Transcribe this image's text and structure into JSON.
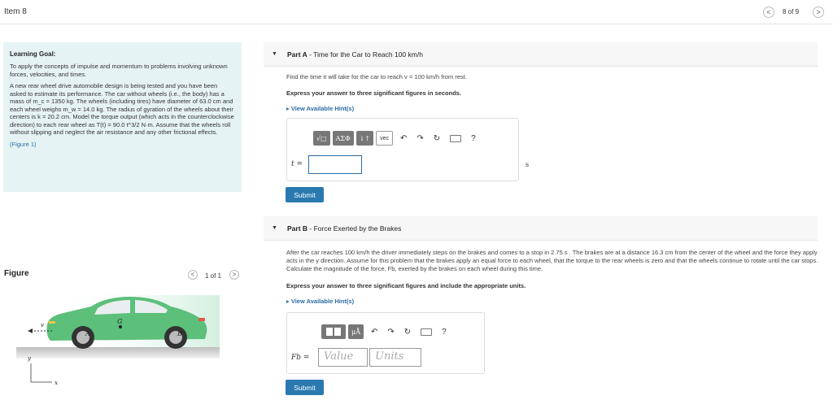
{
  "header": {
    "item_title": "Item 8",
    "nav_prev": "<",
    "nav_next": ">",
    "nav_position": "8 of 9"
  },
  "learning_goal": {
    "title": "Learning Goal:",
    "intro": "To apply the concepts of impulse and momentum to problems involving unknown forces, velocities, and times.",
    "body": "A new rear wheel drive automobile design is being tested and you have been asked to estimate its performance. The car without wheels (i.e., the body) has a mass of m_c = 1350 kg. The wheels (including tires) have diameter of 63.0 cm and each wheel weighs m_w = 14.0 kg. The radius of gyration of the wheels about their centers is k = 20.2 cm. Model the torque output (which acts in the counterclockwise direction) to each rear wheel as T(t) = 90.0 t^3/2 N·m. Assume that the wheels roll without slipping and neglect the air resistance and any other frictional effects.",
    "figure_link": "(Figure 1)"
  },
  "figure": {
    "label": "Figure",
    "count": "1 of 1",
    "prev": "<",
    "next": ">",
    "labels": {
      "v": "v",
      "a": "A",
      "b": "B",
      "g": "G",
      "y": "y",
      "x": "x"
    }
  },
  "part_a": {
    "caret": "▼",
    "label": "Part A",
    "title": "- Time for the Car to Reach 100 km/h",
    "question": "Find the time it will take for the car to reach v = 100 km/h from rest.",
    "instruction": "Express your answer to three significant figures in seconds.",
    "hint": "▸ View Available Hint(s)",
    "toolbar": [
      "√□",
      "ΑΣΦ",
      "↓↑",
      "vec"
    ],
    "var": "t =",
    "unit": "s",
    "submit": "Submit"
  },
  "part_b": {
    "caret": "▼",
    "label": "Part B",
    "title": "- Force Exerted by the Brakes",
    "question": "After the car reaches 100 km/h the driver immediately steps on the brakes and comes to a stop in 2.75 s . The brakes are at a distance 16.3 cm from the center of the wheel and the force they apply acts in the y direction. Assume for this problem that the brakes apply an equal force to each wheel, that the torque to the rear wheels is zero and that the wheels continue to rotate until the car stops. Calculate the magnitude of the force, Fb, exerted by the brakes on each wheel during this time.",
    "instruction": "Express your answer to three significant figures and include the appropriate units.",
    "hint": "▸ View Available Hint(s)",
    "toolbar": [
      "μÅ"
    ],
    "var": "Fb =",
    "value_placeholder": "Value",
    "units_placeholder": "Units",
    "submit": "Submit"
  },
  "toolbar_common": {
    "undo": "↶",
    "redo": "↷",
    "reset": "↻",
    "help": "?"
  },
  "colors": {
    "goal_bg": "#e6f3f5",
    "car_body": "#5cbf7a",
    "submit_bg": "#2a7ab0",
    "link": "#2a6ca6"
  }
}
